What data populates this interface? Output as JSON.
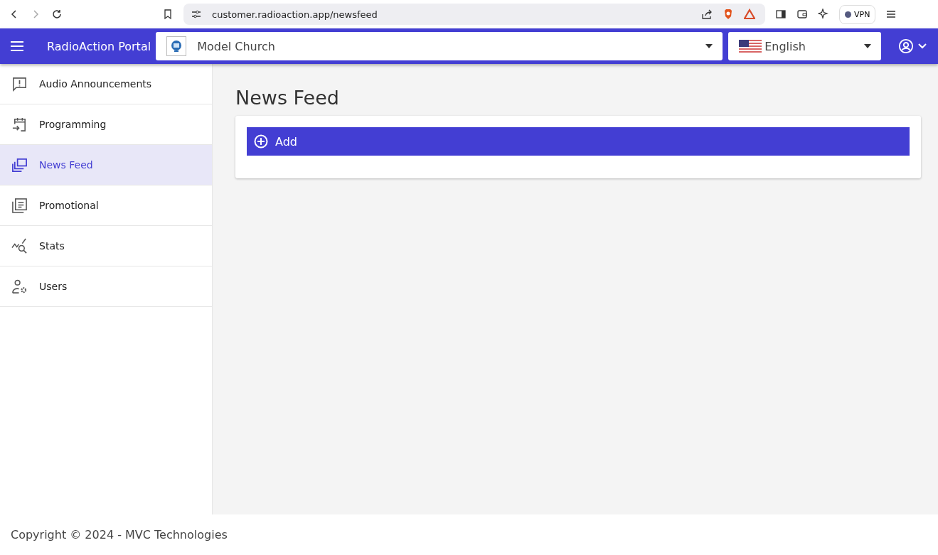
{
  "browser": {
    "url": "customer.radioaction.app/newsfeed",
    "vpn_label": "VPN"
  },
  "header": {
    "title": "RadioAction Portal",
    "organization": "Model Church",
    "language": "English"
  },
  "sidebar": {
    "items": [
      {
        "kind": "announcement",
        "label": "Audio Announcements",
        "selected": false
      },
      {
        "kind": "programming",
        "label": "Programming",
        "selected": false
      },
      {
        "kind": "newsfeed",
        "label": "News Feed",
        "selected": true
      },
      {
        "kind": "promotional",
        "label": "Promotional",
        "selected": false
      },
      {
        "kind": "stats",
        "label": "Stats",
        "selected": false
      },
      {
        "kind": "users",
        "label": "Users",
        "selected": false
      }
    ]
  },
  "page": {
    "title": "News Feed",
    "add_button": "Add"
  },
  "footer": {
    "copyright": "Copyright © 2024 - MVC Technologies"
  }
}
